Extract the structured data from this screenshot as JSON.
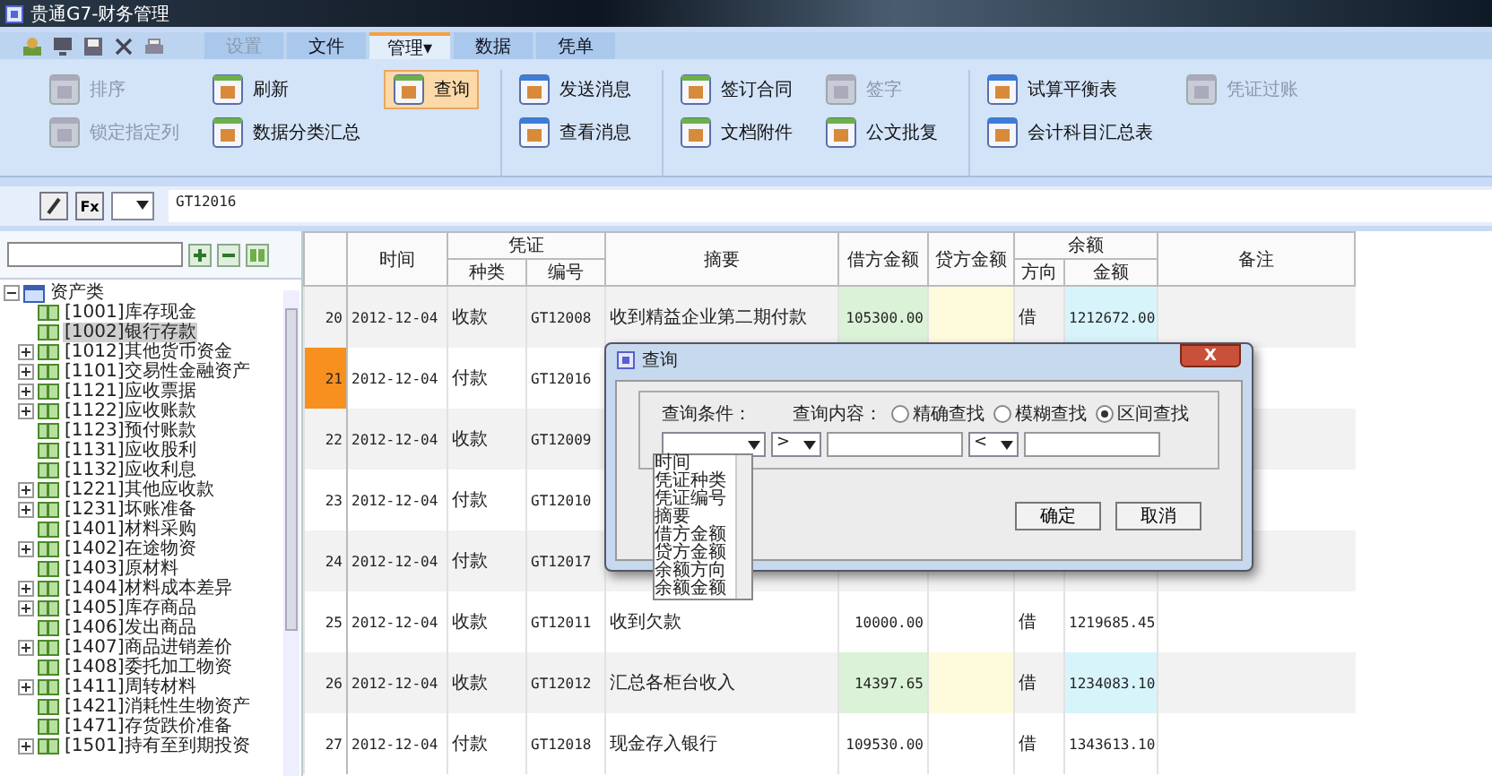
{
  "window": {
    "title": "贵通G7-财务管理"
  },
  "tabs": [
    {
      "label": "设置",
      "selected": false,
      "disabled": true
    },
    {
      "label": "文件",
      "selected": false,
      "disabled": false
    },
    {
      "label": "管理",
      "selected": true,
      "disabled": false,
      "caret": "▾"
    },
    {
      "label": "数据",
      "selected": false,
      "disabled": false
    },
    {
      "label": "凭单",
      "selected": false,
      "disabled": false
    }
  ],
  "ribbon_groups": [
    {
      "buttons": [
        {
          "label": "排序",
          "disabled": true,
          "pressed": false
        },
        {
          "label": "刷新",
          "disabled": false,
          "pressed": false
        },
        {
          "label": "查询",
          "disabled": false,
          "pressed": true
        },
        {
          "label": "锁定指定列",
          "disabled": true,
          "pressed": false
        },
        {
          "label": "数据分类汇总",
          "disabled": false,
          "pressed": false
        }
      ]
    },
    {
      "buttons": [
        {
          "label": "发送消息",
          "disabled": false,
          "pressed": false
        },
        {
          "label": "查看消息",
          "disabled": false,
          "pressed": false
        }
      ]
    },
    {
      "buttons": [
        {
          "label": "签订合同",
          "disabled": false,
          "pressed": false
        },
        {
          "label": "签字",
          "disabled": true,
          "pressed": false
        },
        {
          "label": "文档附件",
          "disabled": false,
          "pressed": false
        },
        {
          "label": "公文批复",
          "disabled": false,
          "pressed": false
        }
      ]
    },
    {
      "buttons": [
        {
          "label": "试算平衡表",
          "disabled": false,
          "pressed": false
        },
        {
          "label": "凭证过账",
          "disabled": true,
          "pressed": false
        },
        {
          "label": "会计科目汇总表",
          "disabled": false,
          "pressed": false
        }
      ]
    }
  ],
  "formula_bar": {
    "fx": "Fx",
    "value": "GT12016"
  },
  "tree": {
    "label": "资产类",
    "expanded": true,
    "children": [
      {
        "label": "[1001]库存现金",
        "expandable": false,
        "selected": false
      },
      {
        "label": "[1002]银行存款",
        "expandable": false,
        "selected": true
      },
      {
        "label": "[1012]其他货币资金",
        "expandable": true,
        "selected": false
      },
      {
        "label": "[1101]交易性金融资产",
        "expandable": true,
        "selected": false
      },
      {
        "label": "[1121]应收票据",
        "expandable": true,
        "selected": false
      },
      {
        "label": "[1122]应收账款",
        "expandable": true,
        "selected": false
      },
      {
        "label": "[1123]预付账款",
        "expandable": false,
        "selected": false
      },
      {
        "label": "[1131]应收股利",
        "expandable": false,
        "selected": false
      },
      {
        "label": "[1132]应收利息",
        "expandable": false,
        "selected": false
      },
      {
        "label": "[1221]其他应收款",
        "expandable": true,
        "selected": false
      },
      {
        "label": "[1231]坏账准备",
        "expandable": true,
        "selected": false
      },
      {
        "label": "[1401]材料采购",
        "expandable": false,
        "selected": false
      },
      {
        "label": "[1402]在途物资",
        "expandable": true,
        "selected": false
      },
      {
        "label": "[1403]原材料",
        "expandable": false,
        "selected": false
      },
      {
        "label": "[1404]材料成本差异",
        "expandable": true,
        "selected": false
      },
      {
        "label": "[1405]库存商品",
        "expandable": true,
        "selected": false
      },
      {
        "label": "[1406]发出商品",
        "expandable": false,
        "selected": false
      },
      {
        "label": "[1407]商品进销差价",
        "expandable": true,
        "selected": false
      },
      {
        "label": "[1408]委托加工物资",
        "expandable": false,
        "selected": false
      },
      {
        "label": "[1411]周转材料",
        "expandable": true,
        "selected": false
      },
      {
        "label": "[1421]消耗性生物资产",
        "expandable": false,
        "selected": false
      },
      {
        "label": "[1471]存货跌价准备",
        "expandable": false,
        "selected": false
      },
      {
        "label": "[1501]持有至到期投资",
        "expandable": true,
        "selected": false
      }
    ]
  },
  "table": {
    "columns": {
      "time": "时间",
      "voucher": "凭证",
      "kind": "种类",
      "number": "编号",
      "summary": "摘要",
      "debit": "借方金额",
      "credit": "贷方金额",
      "balance": "余额",
      "direction": "方向",
      "amount": "金额",
      "note": "备注"
    },
    "rows": [
      {
        "no": "20",
        "selected": false,
        "date": "2012-12-04",
        "kind": "收款",
        "code": "GT12008",
        "summary": "收到精益企业第二期付款",
        "debit": "105300.00",
        "direction": "借",
        "balance": "1212672.00"
      },
      {
        "no": "21",
        "selected": true,
        "date": "2012-12-04",
        "kind": "付款",
        "code": "GT12016"
      },
      {
        "no": "22",
        "selected": false,
        "date": "2012-12-04",
        "kind": "收款",
        "code": "GT12009"
      },
      {
        "no": "23",
        "selected": false,
        "date": "2012-12-04",
        "kind": "付款",
        "code": "GT12010"
      },
      {
        "no": "24",
        "selected": false,
        "date": "2012-12-04",
        "kind": "付款",
        "code": "GT12017"
      },
      {
        "no": "25",
        "selected": false,
        "date": "2012-12-04",
        "kind": "收款",
        "code": "GT12011",
        "summary": "收到欠款",
        "debit": "10000.00",
        "direction": "借",
        "balance": "1219685.45"
      },
      {
        "no": "26",
        "selected": false,
        "date": "2012-12-04",
        "kind": "收款",
        "code": "GT12012",
        "summary": "汇总各柜台收入",
        "debit": "14397.65",
        "direction": "借",
        "balance": "1234083.10"
      },
      {
        "no": "27",
        "selected": false,
        "date": "2012-12-04",
        "kind": "付款",
        "code": "GT12018",
        "summary": "现金存入银行",
        "debit": "109530.00",
        "direction": "借",
        "balance": "1343613.10"
      }
    ]
  },
  "dialog": {
    "title": "查询",
    "close": "X",
    "condition_label": "查询条件：",
    "content_label": "查询内容：",
    "modes": [
      {
        "label": "精确查找",
        "selected": false
      },
      {
        "label": "模糊查找",
        "selected": false
      },
      {
        "label": "区间查找",
        "selected": true
      }
    ],
    "op_from": ">",
    "op_to": "<",
    "field_options": [
      "时间",
      "凭证种类",
      "凭证编号",
      "摘要",
      "借方金额",
      "贷方金额",
      "余额方向",
      "余额金额"
    ],
    "buttons": [
      "确定",
      "取消"
    ]
  }
}
